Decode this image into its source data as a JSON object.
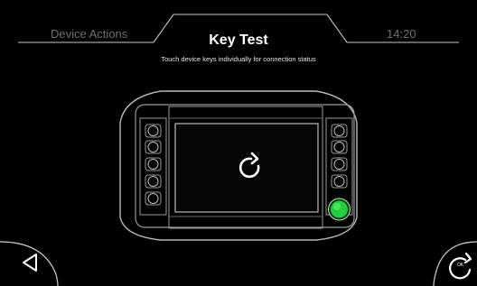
{
  "header": {
    "left_tab": "Device Actions",
    "title": "Key Test",
    "time": "14:20"
  },
  "subtitle": "Touch device keys individually for connection status",
  "device": {
    "left_keys": 5,
    "right_keys": 5,
    "active_key": {
      "side": "right",
      "index": 5,
      "color": "#1fd13a"
    },
    "screen_icon": "refresh-icon"
  },
  "footer": {
    "back_icon": "back-triangle-icon",
    "ok_label": "OK",
    "ok_icon": "refresh-ok-icon"
  },
  "colors": {
    "background": "#000000",
    "outline": "#b9b9b9",
    "muted_text": "#6e6e6e",
    "active": "#1fd13a"
  }
}
